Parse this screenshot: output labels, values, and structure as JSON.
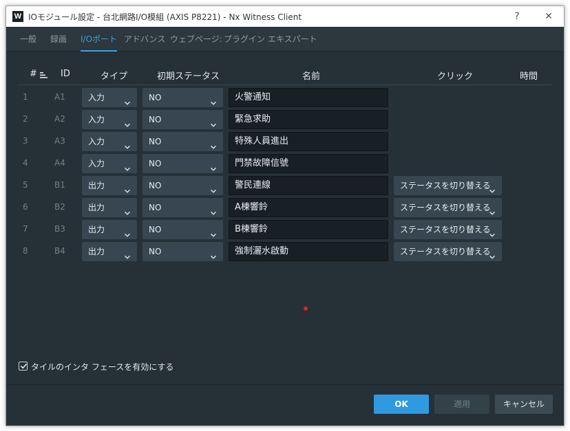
{
  "window": {
    "title": "IOモジュール設定 - 台北網路I/O模組 (AXIS P8221) - Nx Witness Client",
    "logo_text": "W",
    "help_glyph": "?",
    "close_glyph": "✕"
  },
  "tabs": [
    {
      "label": "一般"
    },
    {
      "label": "録画"
    },
    {
      "label": "I/Oポート"
    },
    {
      "label": "アドバンス"
    },
    {
      "label": "ウェブページ:"
    },
    {
      "label": "プラグイン"
    },
    {
      "label": "エキスパート"
    }
  ],
  "active_tab": "I/Oポート",
  "table": {
    "headers": {
      "num": "#",
      "id": "ID",
      "type": "タイプ",
      "initial_status": "初期ステータス",
      "name": "名前",
      "click": "クリック",
      "time": "時間"
    },
    "rows": [
      {
        "num": "1",
        "id": "A1",
        "type": "入力",
        "status": "NO",
        "name": "火警通知",
        "click": ""
      },
      {
        "num": "2",
        "id": "A2",
        "type": "入力",
        "status": "NO",
        "name": "緊急求助",
        "click": ""
      },
      {
        "num": "3",
        "id": "A3",
        "type": "入力",
        "status": "NO",
        "name": "特殊人員進出",
        "click": ""
      },
      {
        "num": "4",
        "id": "A4",
        "type": "入力",
        "status": "NO",
        "name": "門禁故障信號",
        "click": ""
      },
      {
        "num": "5",
        "id": "B1",
        "type": "出力",
        "status": "NO",
        "name": "警民連線",
        "click": "ステータスを切り替える"
      },
      {
        "num": "6",
        "id": "B2",
        "type": "出力",
        "status": "NO",
        "name": "A棟響鈴",
        "click": "ステータスを切り替える"
      },
      {
        "num": "7",
        "id": "B3",
        "type": "出力",
        "status": "NO",
        "name": "B棟響鈴",
        "click": "ステータスを切り替える"
      },
      {
        "num": "8",
        "id": "B4",
        "type": "出力",
        "status": "NO",
        "name": "強制灑水啟動",
        "click": "ステータスを切り替える"
      }
    ]
  },
  "tile_interface": {
    "label": "タイルのインタ フェースを有効にする",
    "checked": true
  },
  "buttons": {
    "ok": "OK",
    "apply": "適用",
    "cancel": "キャンセル"
  },
  "colors": {
    "background": "#263037",
    "accent": "#2f9ae0",
    "input_bg": "#182025",
    "select_bg": "#374650"
  },
  "icons": {
    "sort": "sort-icon",
    "dropdown": "chevron-down-icon",
    "checkbox": "checkmark-icon"
  }
}
